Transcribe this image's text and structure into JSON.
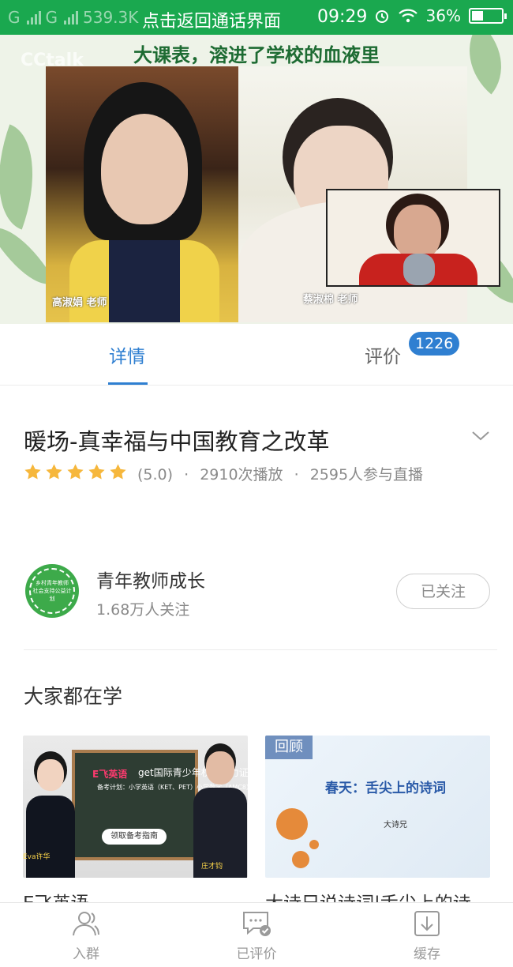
{
  "status_bar": {
    "carrier1": "G",
    "carrier2": "G",
    "speed": "539.3K",
    "center_text": "点击返回通话界面",
    "time": "09:29",
    "battery": "36%"
  },
  "video": {
    "banner_title": "大课表，溶进了学校的血液里",
    "watermark": "CCtalk",
    "teacher_left_caption": "高淑娟 老师",
    "teacher_right_caption": "蔡淑棉 老师"
  },
  "tabs": {
    "detail": "详情",
    "review": "评价",
    "review_count": "1226"
  },
  "course": {
    "title": "暖场-真幸福与中国教育之改革",
    "rating_value": 5.0,
    "rating_text": "(5.0)",
    "plays": "2910次播放",
    "participants": "2595人参与直播",
    "separator": "·"
  },
  "org": {
    "logo_text_top": "乡村青年教师",
    "logo_text_bottom": "社会支持公益计划",
    "name": "青年教师成长",
    "followers": "1.68万人关注",
    "follow_label": "已关注"
  },
  "section": {
    "title": "大家都在学"
  },
  "cards": [
    {
      "caption": "E飞英语",
      "thumb_logo": "E飞英语",
      "thumb_headline": "get国际青少年权威能力证书",
      "thumb_line2": "备考计划：小学英语（KET、PET）小学数学（AMC8）",
      "thumb_button": "领取备考指南",
      "thumb_caption_left": "Eva许华",
      "thumb_caption_right": "庄才钧"
    },
    {
      "caption": "大诗兄说诗词|舌尖上的诗",
      "badge": "回顾",
      "thumb_title": "春天：舌尖上的诗词",
      "thumb_sub": "大诗兄"
    }
  ],
  "bottom_nav": [
    {
      "label": "入群",
      "icon": "group-icon"
    },
    {
      "label": "已评价",
      "icon": "reviewed-icon"
    },
    {
      "label": "缓存",
      "icon": "download-icon"
    }
  ],
  "colors": {
    "status_bar": "#1aa84f",
    "accent": "#2f7fd1",
    "star": "#f6b73c"
  }
}
